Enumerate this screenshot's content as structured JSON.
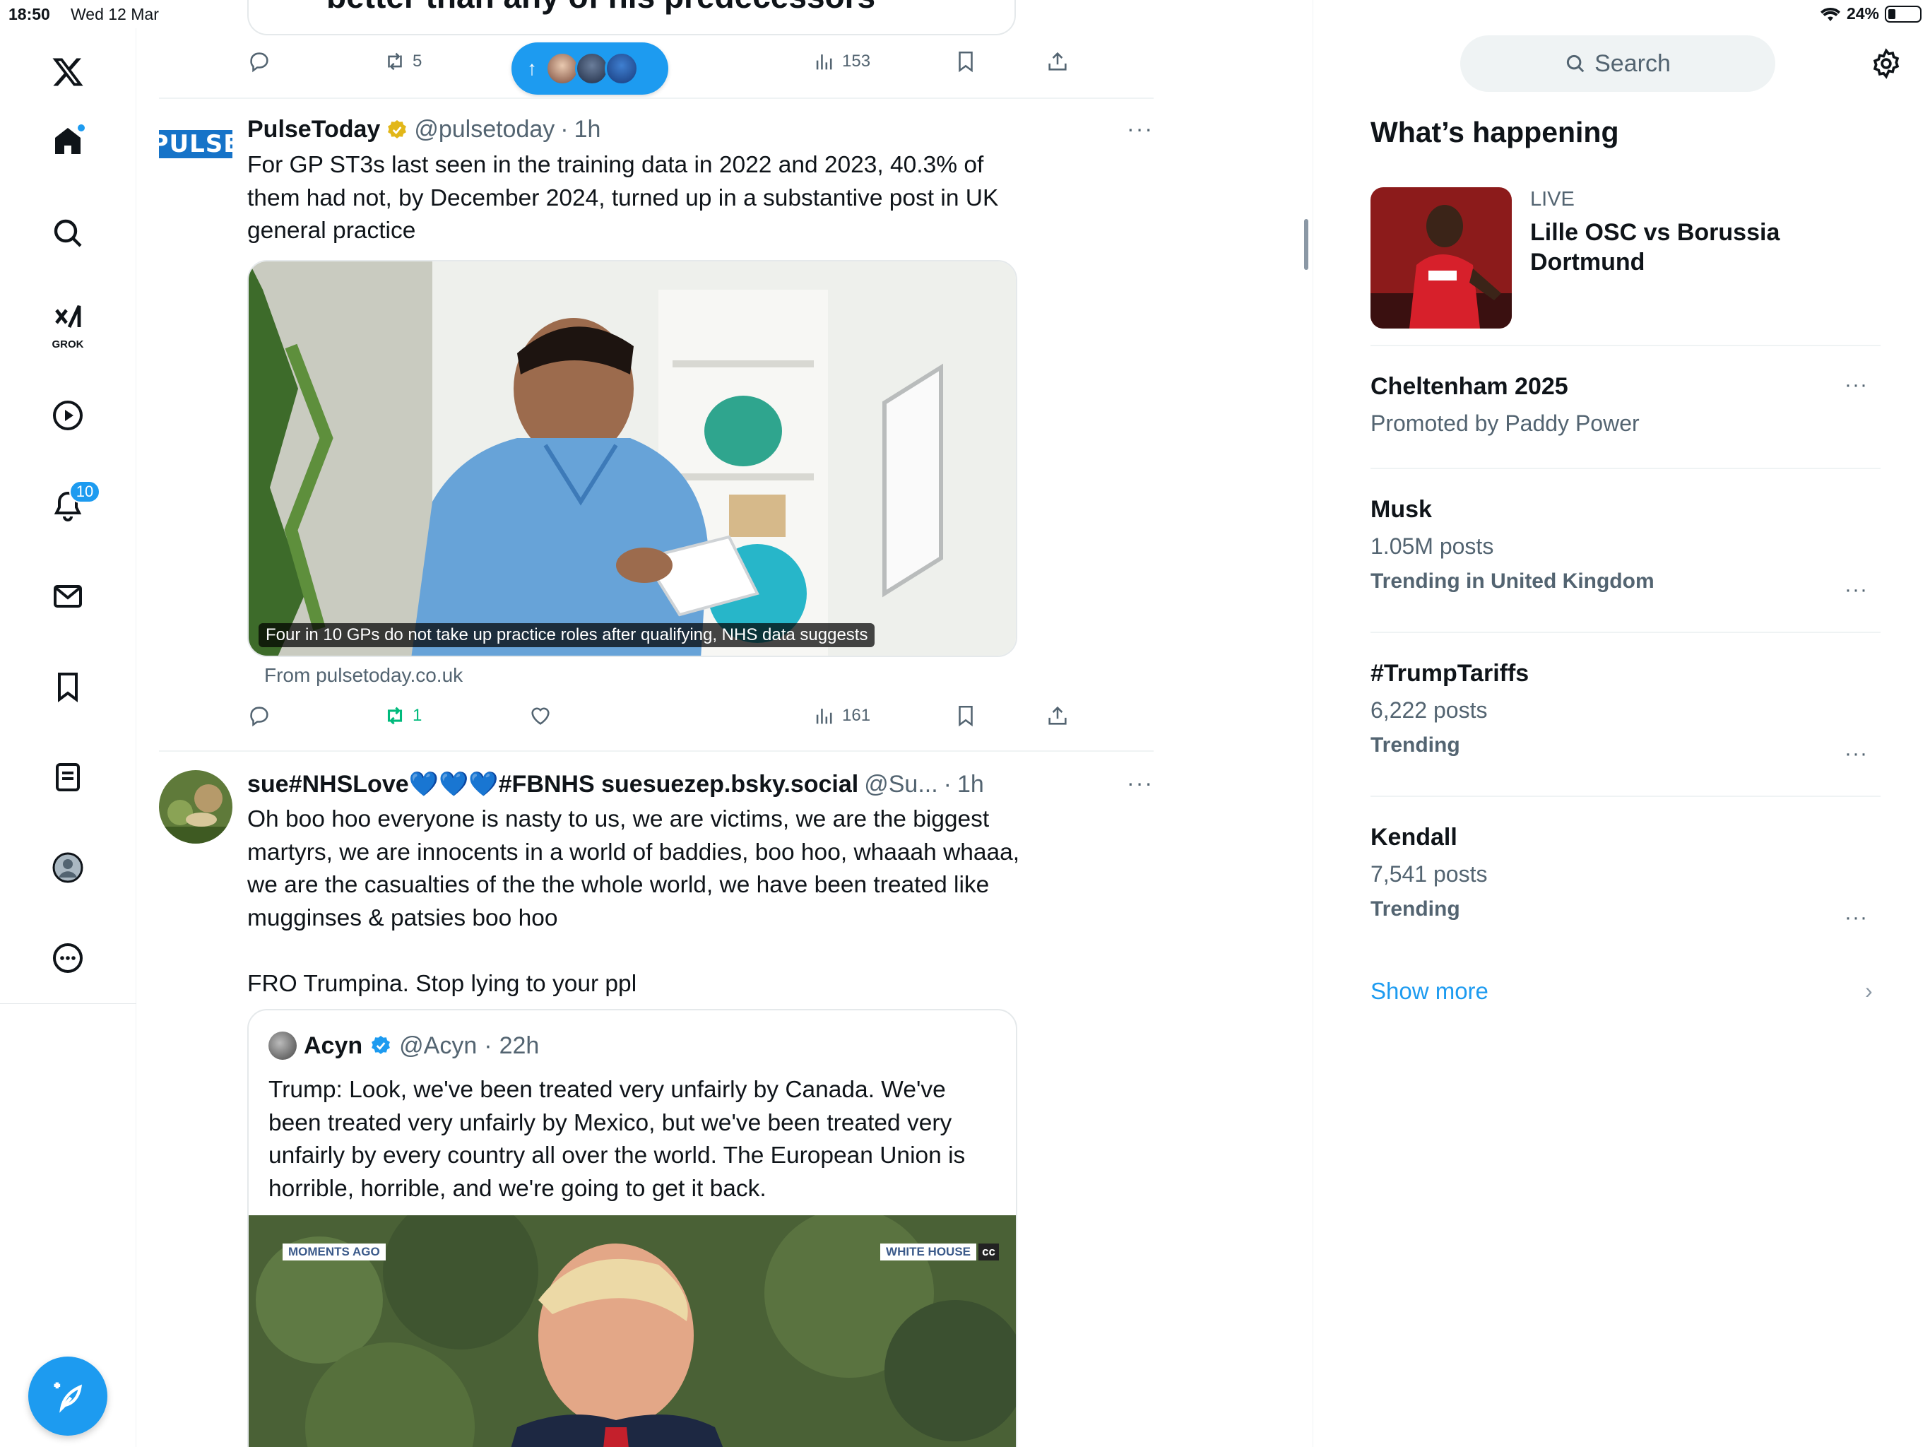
{
  "status": {
    "time": "18:50",
    "date": "Wed 12 Mar",
    "battery": "24%"
  },
  "nav": {
    "notifications_badge": "10",
    "grok_label": "GROK"
  },
  "prev_post": {
    "card_text": "better than any of his predecessors",
    "retweets": "5",
    "views": "153"
  },
  "new_posts_pill": {
    "arrow": "↑"
  },
  "posts": [
    {
      "name": "PulseToday",
      "handle": "@pulsetoday",
      "dot": "·",
      "time": "1h",
      "logo_text": "PULSE",
      "text": "For GP ST3s last seen in the training data in 2022 and 2023, 40.3% of them had not, by December 2024, turned up in a substantive post in UK general practice",
      "media_caption": "Four in 10 GPs do not take up practice roles after qualifying, NHS data suggests",
      "link_source": "From pulsetoday.co.uk",
      "retweets": "1",
      "views": "161"
    },
    {
      "name": "sue#NHSLove💙💙💙#FBNHS suesuezep.bsky.social",
      "handle": "@Su...",
      "dot": "·",
      "time": "1h",
      "text": "Oh boo hoo everyone is nasty to us, we are victims, we are the biggest martyrs, we are innocents in a world of baddies, boo hoo, whaaah whaaa, we are the casualties of the the whole world, we have been treated like mugginses & patsies boo hoo\n\nFRO Trumpina. Stop lying to your ppl",
      "quote": {
        "name": "Acyn",
        "handle": "@Acyn",
        "dot": "·",
        "time": "22h",
        "text": "Trump: Look, we've been treated very unfairly by Canada. We've been treated very unfairly by Mexico, but we've been treated very unfairly by every country all over the world. The European Union is horrible, horrible, and we're going to get it back.",
        "chyron_left": "MOMENTS AGO",
        "chyron_right": "WHITE HOUSE",
        "cc": "cc"
      }
    }
  ],
  "sidebar": {
    "search_placeholder": "Search",
    "title": "What’s happening",
    "live": {
      "label": "LIVE",
      "title": "Lille OSC vs Borussia Dortmund"
    },
    "trends": [
      {
        "title": "Cheltenham 2025",
        "sub": "Promoted by Paddy Power"
      },
      {
        "title": "Musk",
        "posts": "1.05M posts",
        "context": "Trending in United Kingdom"
      },
      {
        "title": "#TrumpTariffs",
        "posts": "6,222 posts",
        "context": "Trending"
      },
      {
        "title": "Kendall",
        "posts": "7,541 posts",
        "context": "Trending"
      }
    ],
    "show_more": "Show more",
    "more_dots": "···"
  },
  "colors": {
    "accent": "#1d9bf0",
    "repost_green": "#00ba7c",
    "muted": "#536471"
  }
}
